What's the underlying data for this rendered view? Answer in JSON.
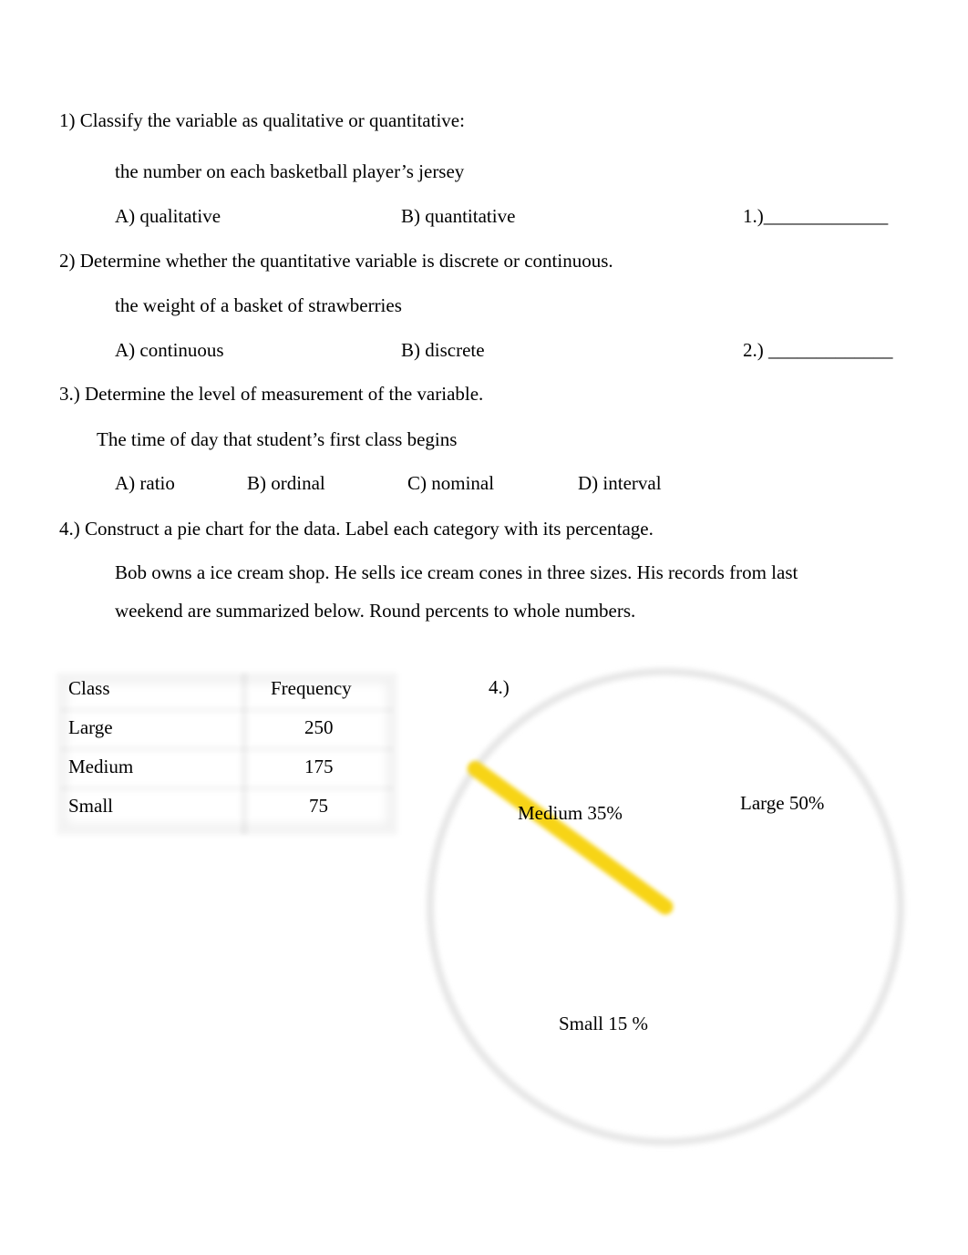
{
  "questions": {
    "q1": {
      "prompt": "1) Classify the variable as qualitative or quantitative:",
      "subject": "the number on each basketball player’s jersey",
      "options": [
        "A) qualitative",
        "B) quantitative"
      ],
      "answer_blank": "1.)_____________"
    },
    "q2": {
      "prompt": "2) Determine whether the quantitative variable is discrete or continuous.",
      "subject": "the weight of a basket of strawberries",
      "options": [
        "A) continuous",
        "B) discrete"
      ],
      "answer_blank": "2.) _____________"
    },
    "q3": {
      "prompt": "3.) Determine the level of measurement of the variable.",
      "subject": "The time of day that student’s first class begins",
      "options": [
        "A) ratio",
        "B) ordinal",
        "C) nominal",
        "D) interval"
      ]
    },
    "q4": {
      "prompt": "4.) Construct a pie chart for the data. Label each category with its percentage.",
      "description_line1": "Bob owns a ice cream shop. He sells ice cream cones in three sizes. His records from last",
      "description_line2": "weekend are summarized below. Round percents to whole numbers.",
      "answer_label": "4.)",
      "table": {
        "headers": [
          "Class",
          "Frequency"
        ],
        "rows": [
          [
            "Large",
            "250"
          ],
          [
            "Medium",
            "175"
          ],
          [
            "Small",
            "75"
          ]
        ]
      }
    }
  },
  "chart_data": {
    "type": "pie",
    "title": "",
    "categories": [
      "Large",
      "Medium",
      "Small"
    ],
    "values": [
      50,
      35,
      15
    ],
    "labels": [
      "Large 50%",
      "Medium 35%",
      "Small 15 %"
    ],
    "style": "hand-drawn yellow divider lines on a faint gray circle",
    "colors": {
      "divider": "#F7D417",
      "circle": "#e6e6e6"
    }
  }
}
